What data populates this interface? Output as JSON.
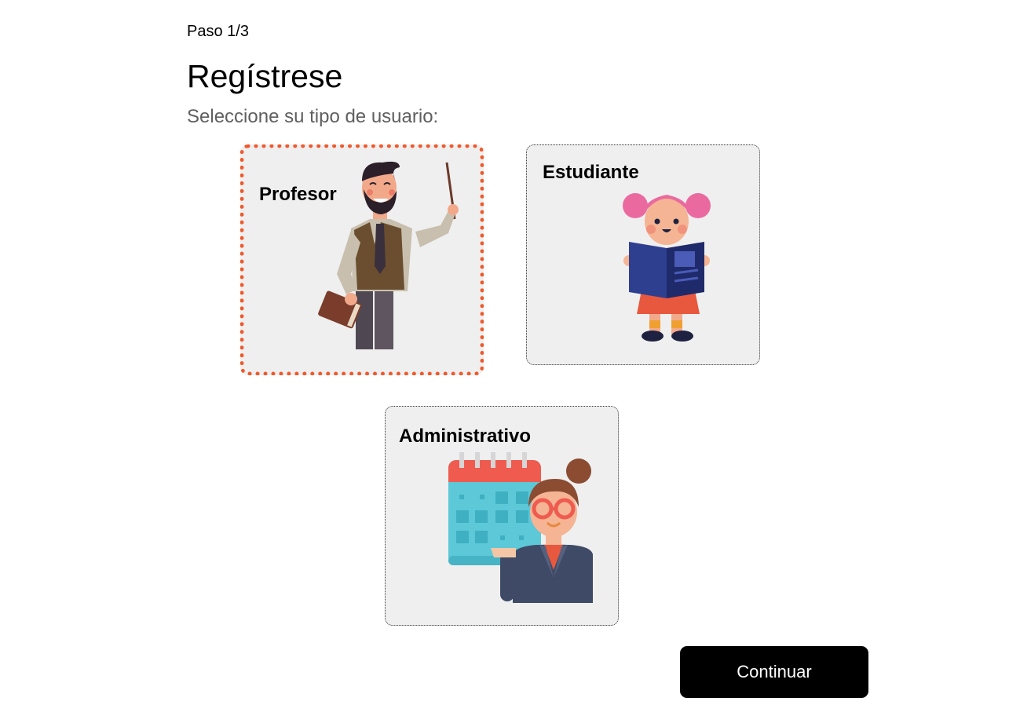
{
  "header": {
    "step": "Paso 1/3",
    "title": "Regístrese",
    "subtitle": "Seleccione su tipo de usuario:"
  },
  "user_types": [
    {
      "label": "Profesor",
      "icon": "teacher-illustration",
      "selected": true
    },
    {
      "label": "Estudiante",
      "icon": "student-illustration",
      "selected": false
    },
    {
      "label": "Administrativo",
      "icon": "administrative-illustration",
      "selected": false
    }
  ],
  "actions": {
    "continue_label": "Continuar"
  },
  "colors": {
    "selected_border": "#f0582a",
    "card_background": "#efefef",
    "button_background": "#000000",
    "button_text": "#ffffff"
  }
}
